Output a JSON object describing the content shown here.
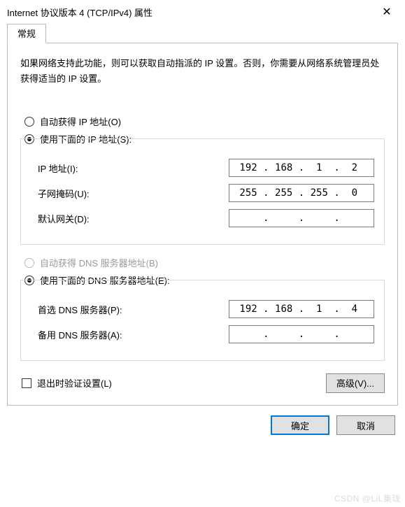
{
  "title": "Internet 协议版本 4 (TCP/IPv4) 属性",
  "tab": {
    "general": "常规"
  },
  "desc": "如果网络支持此功能，则可以获取自动指派的 IP 设置。否则，你需要从网络系统管理员处获得适当的 IP 设置。",
  "ip": {
    "auto_label": "自动获得 IP 地址(O)",
    "manual_label": "使用下面的 IP 地址(S):",
    "addr_label": "IP 地址(I):",
    "mask_label": "子网掩码(U):",
    "gw_label": "默认网关(D):",
    "addr": {
      "o1": "192",
      "o2": "168",
      "o3": "1",
      "o4": "2"
    },
    "mask": {
      "o1": "255",
      "o2": "255",
      "o3": "255",
      "o4": "0"
    },
    "gw": {
      "o1": "",
      "o2": "",
      "o3": "",
      "o4": ""
    }
  },
  "dns": {
    "auto_label": "自动获得 DNS 服务器地址(B)",
    "manual_label": "使用下面的 DNS 服务器地址(E):",
    "pref_label": "首选 DNS 服务器(P):",
    "alt_label": "备用 DNS 服务器(A):",
    "pref": {
      "o1": "192",
      "o2": "168",
      "o3": "1",
      "o4": "4"
    },
    "alt": {
      "o1": "",
      "o2": "",
      "o3": "",
      "o4": ""
    }
  },
  "validate_label": "退出时验证设置(L)",
  "buttons": {
    "advanced": "高级(V)...",
    "ok": "确定",
    "cancel": "取消"
  },
  "watermark": "CSDN @LiL集珑"
}
